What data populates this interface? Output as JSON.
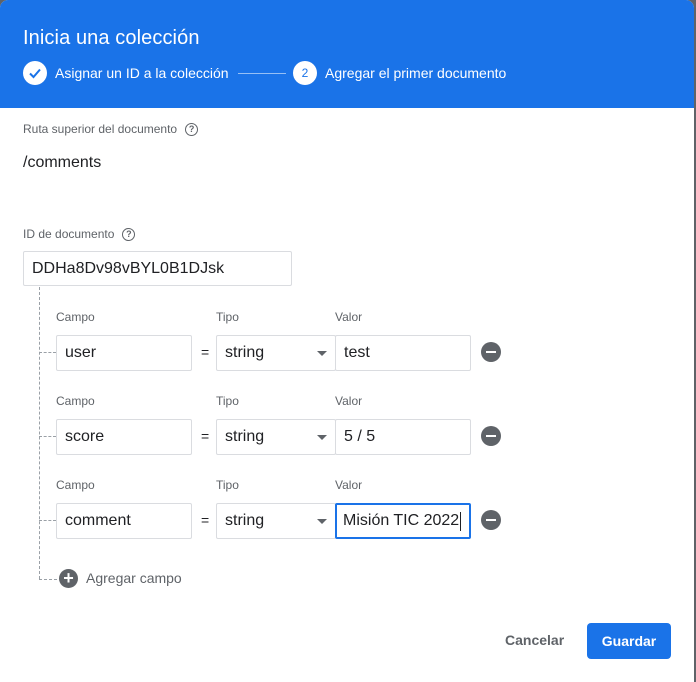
{
  "dialog": {
    "title": "Inicia una colección",
    "steps": [
      {
        "number": "✓",
        "label": "Asignar un ID a la colección",
        "state": "done"
      },
      {
        "number": "2",
        "label": "Agregar el primer documento",
        "state": "active"
      }
    ]
  },
  "parent_path": {
    "label": "Ruta superior del documento",
    "help_icon": "?",
    "value": "/comments"
  },
  "document_id": {
    "label": "ID de documento",
    "help_icon": "?",
    "value": "DDHa8Dv98vBYL0B1DJsk"
  },
  "fields": [
    {
      "campo_label": "Campo",
      "tipo_label": "Tipo",
      "valor_label": "Valor",
      "name": "user",
      "equals": "=",
      "type": "string",
      "value": "test"
    },
    {
      "campo_label": "Campo",
      "tipo_label": "Tipo",
      "valor_label": "Valor",
      "name": "score",
      "equals": "=",
      "type": "string",
      "value": "5 / 5"
    },
    {
      "campo_label": "Campo",
      "tipo_label": "Tipo",
      "valor_label": "Valor",
      "name": "comment",
      "equals": "=",
      "type": "string",
      "value": "Misión TIC 2022"
    }
  ],
  "add_field": {
    "icon": "+",
    "label": "Agregar campo"
  },
  "actions": {
    "cancel": "Cancelar",
    "save": "Guardar"
  },
  "colors": {
    "primary": "#1a73e8",
    "icon_gray": "#5f6368"
  }
}
